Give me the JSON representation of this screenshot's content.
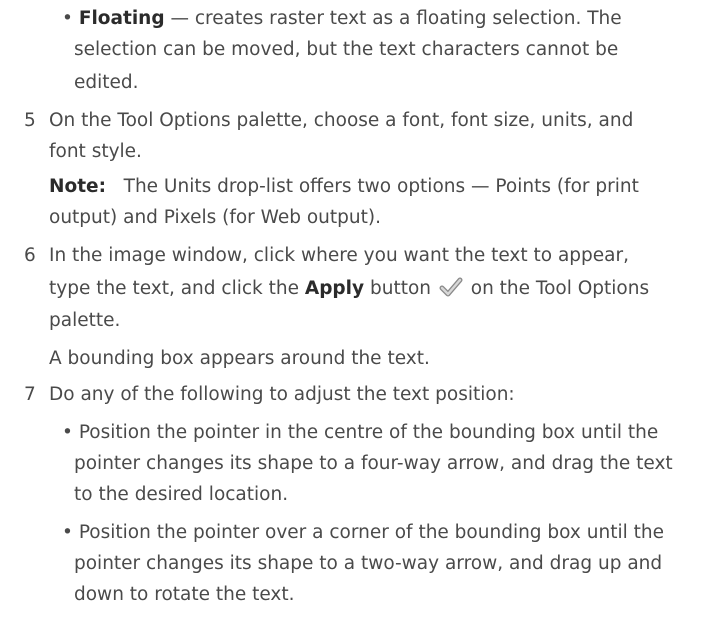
{
  "bullet": "•",
  "floating": {
    "label": "Floating",
    "line1": " — creates raster text as a floating selection. The",
    "line2": "selection can be moved, but the text characters cannot be",
    "line3": "edited."
  },
  "step5": {
    "number": "5",
    "line1": "On the Tool Options palette, choose a font, font size, units, and",
    "line2": "font style."
  },
  "note": {
    "label": "Note:",
    "line1": "The Units drop-list offers two options — Points (for print",
    "line2": "output) and Pixels (for Web output)."
  },
  "step6": {
    "number": "6",
    "line1": "In the image window, click where you want the text to appear,",
    "line2_pre": "type the text, and click the ",
    "apply_label": "Apply",
    "line2_post_a": " button ",
    "line2_post_b": " on the Tool Options",
    "line3": "palette.",
    "result": "A bounding box appears around the text."
  },
  "step7": {
    "number": "7",
    "intro": "Do any of the following to adjust the text position:",
    "bullets": [
      {
        "line1": "Position the pointer in the centre of the bounding box until the",
        "line2": "pointer changes its shape to a four-way arrow, and drag the text",
        "line3": "to the desired location."
      },
      {
        "line1": "Position the pointer over a corner of the bounding box until the",
        "line2": "pointer changes its shape to a two-way arrow, and drag up and",
        "line3": "down to rotate the text."
      }
    ]
  }
}
